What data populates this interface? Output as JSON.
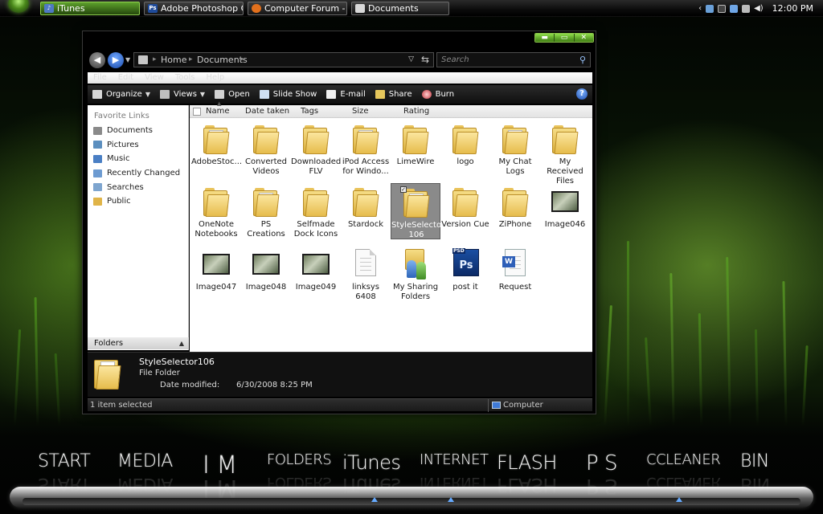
{
  "taskbar": {
    "buttons": [
      {
        "label": "iTunes",
        "icon": "itunes-icon",
        "active": true
      },
      {
        "label": "Adobe Photoshop C...",
        "icon": "photoshop-icon",
        "active": false
      },
      {
        "label": "Computer Forum - ...",
        "icon": "firefox-icon",
        "active": false
      },
      {
        "label": "Documents",
        "icon": "folder-icon",
        "active": false
      }
    ],
    "clock": "12:00 PM"
  },
  "window": {
    "controls": {
      "minimize": "▬",
      "maximize": "▭",
      "close": "✕"
    },
    "breadcrumb": [
      "Home",
      "Documents"
    ],
    "search_placeholder": "Search",
    "menu": [
      "File",
      "Edit",
      "View",
      "Tools",
      "Help"
    ],
    "toolbar": [
      {
        "label": "Organize",
        "icon": "organize-icon",
        "dropdown": true
      },
      {
        "label": "Views",
        "icon": "views-icon",
        "dropdown": true
      },
      {
        "label": "Open",
        "icon": "open-icon",
        "dropdown": false
      },
      {
        "label": "Slide Show",
        "icon": "slideshow-icon",
        "dropdown": false
      },
      {
        "label": "E-mail",
        "icon": "email-icon",
        "dropdown": false
      },
      {
        "label": "Share",
        "icon": "share-icon",
        "dropdown": false
      },
      {
        "label": "Burn",
        "icon": "burn-icon",
        "dropdown": false
      }
    ],
    "help_label": "?",
    "favorite_links_heading": "Favorite Links",
    "favorite_links": [
      {
        "label": "Documents",
        "icon": "documents-icon",
        "color": "#8a8a8a"
      },
      {
        "label": "Pictures",
        "icon": "pictures-icon",
        "color": "#5c8fbf"
      },
      {
        "label": "Music",
        "icon": "music-icon",
        "color": "#4a7fc4"
      },
      {
        "label": "Recently Changed",
        "icon": "recent-icon",
        "color": "#6d9bd1"
      },
      {
        "label": "Searches",
        "icon": "searches-icon",
        "color": "#7ea5cf"
      },
      {
        "label": "Public",
        "icon": "public-folder-icon",
        "color": "#e0b448"
      }
    ],
    "folders_label": "Folders",
    "columns": [
      "Name",
      "Date taken",
      "Tags",
      "Size",
      "Rating"
    ],
    "items": [
      {
        "label": "AdobeStoc...",
        "kind": "folder"
      },
      {
        "label": "Converted Videos",
        "kind": "folder"
      },
      {
        "label": "Downloaded FLV",
        "kind": "folder"
      },
      {
        "label": "iPod Access for Windo...",
        "kind": "folder"
      },
      {
        "label": "LimeWire",
        "kind": "folder"
      },
      {
        "label": "logo",
        "kind": "folder"
      },
      {
        "label": "My Chat Logs",
        "kind": "folder"
      },
      {
        "label": "My Received Files",
        "kind": "folder"
      },
      {
        "label": "OneNote Notebooks",
        "kind": "folder"
      },
      {
        "label": "PS Creations",
        "kind": "folder"
      },
      {
        "label": "Selfmade Dock Icons",
        "kind": "folder"
      },
      {
        "label": "Stardock",
        "kind": "folder"
      },
      {
        "label": "StyleSelector 106",
        "kind": "folder",
        "selected": true
      },
      {
        "label": "Version Cue",
        "kind": "folder"
      },
      {
        "label": "ZiPhone",
        "kind": "folder"
      },
      {
        "label": "Image046",
        "kind": "image"
      },
      {
        "label": "Image047",
        "kind": "image"
      },
      {
        "label": "Image048",
        "kind": "image"
      },
      {
        "label": "Image049",
        "kind": "image"
      },
      {
        "label": "linksys 6408",
        "kind": "document"
      },
      {
        "label": "My Sharing Folders",
        "kind": "sharing"
      },
      {
        "label": "post it",
        "kind": "psd"
      },
      {
        "label": "Request",
        "kind": "word"
      }
    ],
    "details": {
      "name": "StyleSelector106",
      "type": "File Folder",
      "modified_label": "Date modified:",
      "modified_value": "6/30/2008 8:25 PM"
    },
    "status": {
      "left": "1 item selected",
      "right": "Computer"
    }
  },
  "dock": {
    "items": [
      "START",
      "MEDIA",
      "I M",
      "FOLDERS",
      "iTunes",
      "INTERNET",
      "FLASH",
      "P S",
      "CCLEANER",
      "BIN"
    ]
  },
  "colors": {
    "accent_green": "#5ea12c",
    "selection_gray": "#8a8a8a",
    "folder_yellow": "#e6bc4c"
  }
}
